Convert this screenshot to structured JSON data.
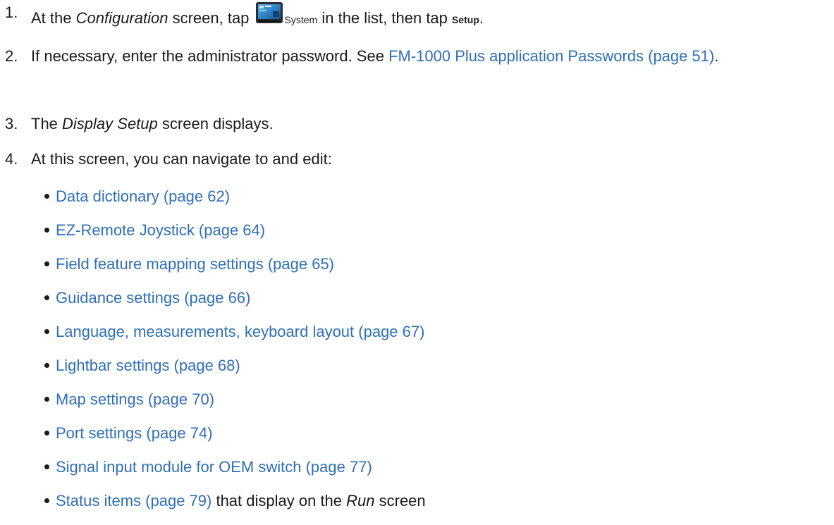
{
  "steps": [
    {
      "num": "1.",
      "text_a": "At the ",
      "emph": "Configuration",
      "text_b": " screen, tap ",
      "icon": "system-display-icon",
      "icon_label": "System",
      "text_c": " in the list, then tap ",
      "bold": "Setup",
      "text_d": "."
    },
    {
      "num": "2.",
      "text_a": "If necessary, enter the administrator password. See ",
      "link": "FM-1000 Plus application Passwords (page 51)",
      "text_b": "."
    },
    {
      "num": "3.",
      "text_a": "The ",
      "emph": "Display Setup",
      "text_b": " screen displays."
    },
    {
      "num": "4.",
      "text_a": "At this screen, you can navigate to and edit:"
    }
  ],
  "bullets": [
    {
      "link": "Data dictionary (page 62)"
    },
    {
      "link": "EZ-Remote Joystick (page 64)"
    },
    {
      "link": "Field feature mapping settings (page 65)"
    },
    {
      "link": "Guidance settings (page 66)"
    },
    {
      "link": "Language, measurements, keyboard layout (page 67)"
    },
    {
      "link": "Lightbar settings (page 68)"
    },
    {
      "link": "Map settings (page 70)"
    },
    {
      "link": "Port settings (page 74)"
    },
    {
      "link": "Signal input module for OEM switch (page 77)"
    },
    {
      "link": "Status items (page 79)",
      "tail_a": " that display on the ",
      "emph": "Run",
      "tail_b": " screen"
    }
  ],
  "colors": {
    "link": "#2f6fb7",
    "text": "#1a1a1a"
  }
}
